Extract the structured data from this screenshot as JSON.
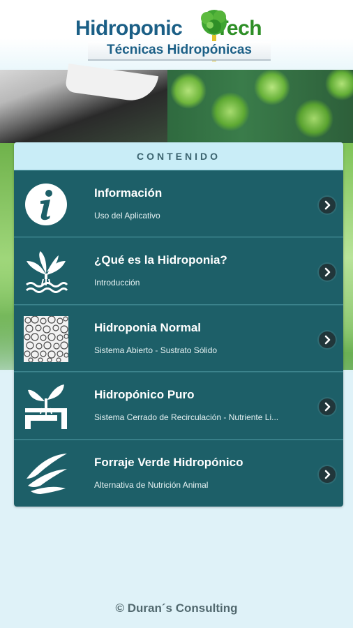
{
  "header": {
    "logo_word1": "Hidroponic",
    "logo_word2": "Tech",
    "logo_subtitle": "Técnicas Hidropónicas"
  },
  "panel": {
    "title": "CONTENIDO",
    "items": [
      {
        "title": "Información",
        "subtitle": "Uso del Aplicativo",
        "icon": "info-icon"
      },
      {
        "title": "¿Qué es la Hidroponia?",
        "subtitle": "Introducción",
        "icon": "plant-water-icon"
      },
      {
        "title": "Hidroponia Normal",
        "subtitle": "Sistema Abierto - Sustrato Sólido",
        "icon": "substrate-icon"
      },
      {
        "title": "Hidropónico Puro",
        "subtitle": "Sistema Cerrado de Recirculación - Nutriente Li...",
        "icon": "pipe-plant-icon"
      },
      {
        "title": "Forraje Verde Hidropónico",
        "subtitle": "Alternativa de Nutrición Animal",
        "icon": "leaves-icon"
      }
    ]
  },
  "footer": {
    "text": "© Duran´s Consulting"
  },
  "colors": {
    "item_bg": "#1d5f68",
    "header_bg": "#c9edf7",
    "page_bg": "#dff2f8",
    "logo_blue": "#1b5f86",
    "logo_green": "#2e8f27"
  }
}
